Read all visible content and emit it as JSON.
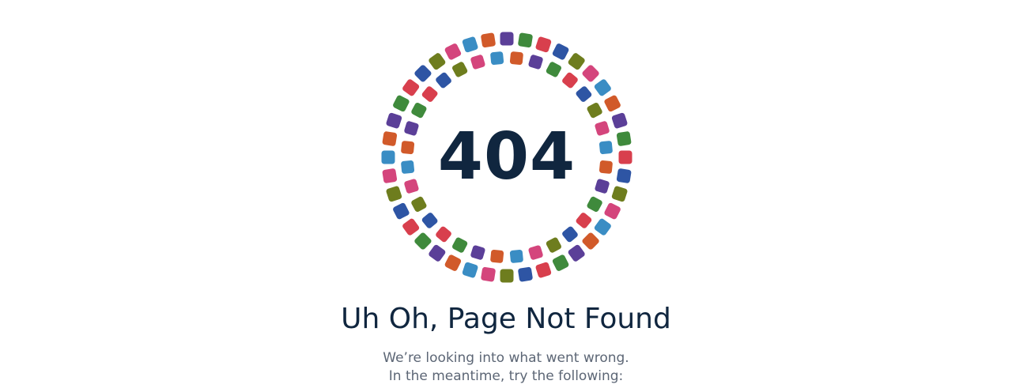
{
  "error": {
    "code": "404",
    "title": "Uh Oh, Page Not Found",
    "lines": [
      "We’re looking into what went wrong.",
      "In the meantime, try the following:"
    ]
  },
  "ring": {
    "icon": "dotted-color-ring-illustration",
    "palette": [
      "#5b3f98",
      "#2e55a4",
      "#3a8dc4",
      "#3f8a3c",
      "#6e7d1e",
      "#d15a2a",
      "#d83f4d",
      "#d4457c"
    ]
  }
}
